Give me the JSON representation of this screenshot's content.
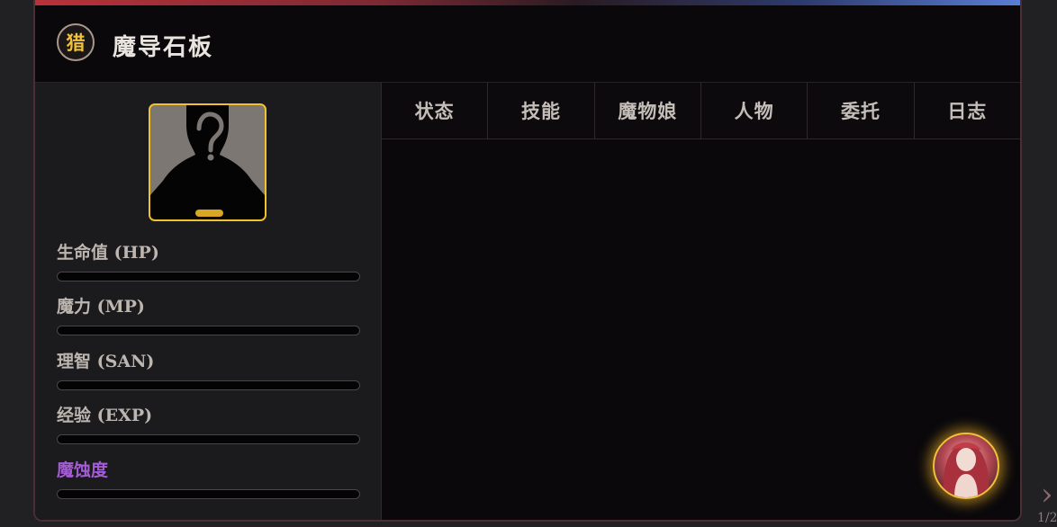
{
  "header": {
    "badge": "猎",
    "title": "魔导石板"
  },
  "stats": [
    {
      "label": "生命值 (HP)",
      "value": 0
    },
    {
      "label": "魔力 (MP)",
      "value": 0
    },
    {
      "label": "理智 (SAN)",
      "value": 0
    },
    {
      "label": "经验 (EXP)",
      "value": 0
    },
    {
      "label": "魔蚀度",
      "value": 0
    }
  ],
  "tabs": [
    "状态",
    "技能",
    "魔物娘",
    "人物",
    "委托",
    "日志"
  ],
  "pagination": {
    "page": "1/2"
  },
  "icons": {
    "avatar": "unknown-silhouette-icon",
    "floater": "character-portrait-icon",
    "next": "chevron-right-icon"
  },
  "colors": {
    "accent_gold": "#f0c230",
    "magic_purple": "#a45bd6",
    "panel_bg": "#0b090c"
  }
}
